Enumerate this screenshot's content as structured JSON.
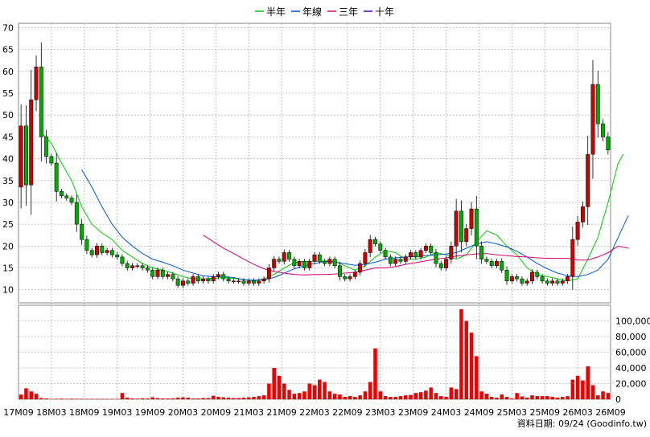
{
  "legend": [
    {
      "name": "半年",
      "color": "#00cc00"
    },
    {
      "name": "年線",
      "color": "#0055dd"
    },
    {
      "name": "三年",
      "color": "#dd0077"
    },
    {
      "name": "十年",
      "color": "#5500aa"
    }
  ],
  "footer_note": "資料日期: 09/24  (Goodinfo.tw)",
  "colors": {
    "up": "#cc0000",
    "down": "#00aa00",
    "volume": "#ee0000",
    "grid": "#999999"
  },
  "chart_data": {
    "type": "candlestick",
    "price_axis": {
      "min": 7,
      "max": 71,
      "ticks": [
        10,
        15,
        20,
        25,
        30,
        35,
        40,
        45,
        50,
        55,
        60,
        65,
        70
      ]
    },
    "volume_axis": {
      "min": 0,
      "max": 120000,
      "ticks": [
        0,
        20000,
        40000,
        60000,
        80000,
        100000
      ],
      "tick_labels": [
        "0",
        "20,000",
        "40,000",
        "60,000",
        "80,000",
        "100,000"
      ]
    },
    "x_labels": [
      "17M09",
      "18M03",
      "18M09",
      "19M03",
      "19M09",
      "20M03",
      "20M09",
      "21M03",
      "21M09",
      "22M03",
      "22M09",
      "23M03",
      "23M09",
      "24M03",
      "24M09",
      "25M03",
      "25M09",
      "26M03",
      "26M09"
    ],
    "close": [
      47.5,
      34,
      53.5,
      61,
      45,
      40.5,
      39,
      32.5,
      31.5,
      31,
      30,
      25,
      21.5,
      19,
      18,
      20,
      18.5,
      19,
      18,
      17.5,
      16,
      15,
      15.5,
      15.5,
      15,
      14.5,
      13,
      14.5,
      13,
      13.5,
      12.5,
      11,
      12,
      11.5,
      13,
      12,
      12.5,
      12,
      13,
      13.5,
      12.5,
      12,
      12,
      12,
      11.5,
      12,
      11.5,
      12,
      12.5,
      15,
      17,
      16.5,
      18.5,
      17,
      15.5,
      16.5,
      15,
      16.5,
      18,
      16.5,
      16,
      17,
      15.5,
      13,
      12.5,
      13,
      14,
      16,
      18.5,
      21.5,
      20.5,
      19,
      17.5,
      16,
      17,
      16.5,
      17.5,
      18.5,
      17.5,
      19,
      20,
      18.5,
      16,
      15,
      17,
      20,
      28,
      21,
      24,
      28.5,
      20,
      17,
      16.5,
      15.5,
      16.5,
      14.5,
      12,
      13,
      12.5,
      11.5,
      12,
      14,
      13,
      12,
      11.5,
      12,
      11.5,
      12,
      13,
      21.5,
      25.5,
      29,
      41,
      57,
      48,
      45,
      42
    ],
    "volume": [
      6000,
      14000,
      10000,
      7000,
      1500,
      1000,
      500,
      600,
      800,
      500,
      700,
      600,
      600,
      500,
      500,
      400,
      400,
      300,
      500,
      400,
      8000,
      2000,
      1000,
      800,
      1200,
      1000,
      2500,
      1500,
      1000,
      1000,
      1200,
      2000,
      2500,
      2000,
      1000,
      1000,
      1500,
      1500,
      4500,
      3000,
      2500,
      2000,
      1500,
      1500,
      2000,
      2500,
      3000,
      4000,
      5000,
      20000,
      40000,
      30000,
      20000,
      12000,
      7000,
      8000,
      10000,
      20000,
      18000,
      25000,
      22000,
      10000,
      7000,
      6000,
      3000,
      4000,
      3000,
      5000,
      10000,
      22000,
      65000,
      10000,
      4000,
      3000,
      3000,
      4000,
      5000,
      5500,
      8000,
      9000,
      11000,
      15000,
      8000,
      4000,
      3000,
      15000,
      13000,
      115000,
      100000,
      85000,
      55000,
      10000,
      7000,
      3000,
      2000,
      6000,
      3000,
      1000,
      8000,
      3500,
      2000,
      5000,
      4000,
      4000,
      4000,
      3000,
      2000,
      3000,
      4000,
      25000,
      30000,
      24000,
      42000,
      18000,
      5000,
      10000,
      8000
    ],
    "ma_halfyear": [
      [
        4,
        46
      ],
      [
        6,
        43.5
      ],
      [
        8,
        39
      ],
      [
        10,
        35
      ],
      [
        12,
        29
      ],
      [
        14,
        25
      ],
      [
        16,
        23
      ],
      [
        18,
        21.5
      ],
      [
        20,
        19
      ],
      [
        22,
        17.5
      ],
      [
        24,
        16
      ],
      [
        26,
        15
      ],
      [
        28,
        14.5
      ],
      [
        30,
        13.8
      ],
      [
        32,
        13
      ],
      [
        34,
        12.5
      ],
      [
        36,
        12.5
      ],
      [
        38,
        12.6
      ],
      [
        40,
        12.8
      ],
      [
        42,
        12.6
      ],
      [
        44,
        12.4
      ],
      [
        46,
        12
      ],
      [
        48,
        12.5
      ],
      [
        50,
        13.5
      ],
      [
        52,
        15
      ],
      [
        54,
        16.2
      ],
      [
        56,
        16.5
      ],
      [
        58,
        16.5
      ],
      [
        60,
        16.6
      ],
      [
        62,
        16.5
      ],
      [
        64,
        15.5
      ],
      [
        66,
        14.5
      ],
      [
        68,
        15.5
      ],
      [
        70,
        17.5
      ],
      [
        72,
        19
      ],
      [
        74,
        18.5
      ],
      [
        76,
        17
      ],
      [
        78,
        17
      ],
      [
        80,
        17.5
      ],
      [
        82,
        18.5
      ],
      [
        84,
        18
      ],
      [
        86,
        17
      ],
      [
        88,
        18
      ],
      [
        90,
        21
      ],
      [
        92,
        23.5
      ],
      [
        94,
        22.5
      ],
      [
        96,
        20
      ],
      [
        98,
        18
      ],
      [
        100,
        15
      ],
      [
        102,
        13.5
      ],
      [
        104,
        13
      ],
      [
        106,
        12.5
      ],
      [
        108,
        12
      ],
      [
        110,
        12.5
      ],
      [
        112,
        17
      ],
      [
        114,
        22
      ],
      [
        116,
        30
      ],
      [
        118,
        39
      ],
      [
        119,
        41
      ]
    ],
    "ma_year": [
      [
        12,
        37.5
      ],
      [
        14,
        33.5
      ],
      [
        16,
        29
      ],
      [
        18,
        25
      ],
      [
        20,
        22
      ],
      [
        22,
        20
      ],
      [
        24,
        18.3
      ],
      [
        26,
        17
      ],
      [
        28,
        16.3
      ],
      [
        30,
        15.5
      ],
      [
        32,
        14.5
      ],
      [
        34,
        13.8
      ],
      [
        36,
        13.2
      ],
      [
        38,
        13
      ],
      [
        40,
        13
      ],
      [
        42,
        12.8
      ],
      [
        44,
        12.3
      ],
      [
        46,
        12.2
      ],
      [
        48,
        12.3
      ],
      [
        50,
        12.8
      ],
      [
        52,
        13.8
      ],
      [
        54,
        14.8
      ],
      [
        56,
        15.5
      ],
      [
        58,
        16
      ],
      [
        60,
        16.5
      ],
      [
        62,
        16.3
      ],
      [
        64,
        16
      ],
      [
        66,
        15.6
      ],
      [
        68,
        15.8
      ],
      [
        70,
        16.3
      ],
      [
        72,
        17
      ],
      [
        74,
        17.3
      ],
      [
        76,
        17.5
      ],
      [
        78,
        17.6
      ],
      [
        80,
        17.8
      ],
      [
        82,
        18
      ],
      [
        84,
        18.2
      ],
      [
        86,
        18.5
      ],
      [
        88,
        19.5
      ],
      [
        90,
        20.5
      ],
      [
        92,
        21
      ],
      [
        94,
        20.5
      ],
      [
        96,
        19.8
      ],
      [
        98,
        18.8
      ],
      [
        100,
        17.5
      ],
      [
        102,
        16
      ],
      [
        104,
        14.8
      ],
      [
        106,
        13.8
      ],
      [
        108,
        13.2
      ],
      [
        110,
        13
      ],
      [
        112,
        13.5
      ],
      [
        114,
        14.5
      ],
      [
        116,
        17
      ],
      [
        118,
        22
      ],
      [
        120,
        27
      ]
    ],
    "ma_3year": [
      [
        36,
        22.5
      ],
      [
        38,
        21
      ],
      [
        40,
        19.5
      ],
      [
        42,
        18.3
      ],
      [
        44,
        17
      ],
      [
        46,
        15.8
      ],
      [
        48,
        14.8
      ],
      [
        50,
        14.2
      ],
      [
        52,
        13.8
      ],
      [
        54,
        13.5
      ],
      [
        56,
        13.4
      ],
      [
        58,
        13.5
      ],
      [
        60,
        13.5
      ],
      [
        62,
        13.6
      ],
      [
        64,
        13.8
      ],
      [
        66,
        14
      ],
      [
        68,
        14.5
      ],
      [
        70,
        15
      ],
      [
        72,
        15
      ],
      [
        74,
        15.3
      ],
      [
        76,
        15.8
      ],
      [
        78,
        16.2
      ],
      [
        80,
        16.6
      ],
      [
        82,
        17
      ],
      [
        84,
        17.3
      ],
      [
        86,
        17.7
      ],
      [
        88,
        18
      ],
      [
        90,
        18.2
      ],
      [
        92,
        18.3
      ],
      [
        94,
        18
      ],
      [
        96,
        17.8
      ],
      [
        98,
        17.6
      ],
      [
        100,
        17.5
      ],
      [
        102,
        17.3
      ],
      [
        104,
        17.2
      ],
      [
        106,
        17.2
      ],
      [
        108,
        17.2
      ],
      [
        110,
        16.8
      ],
      [
        112,
        16.8
      ],
      [
        114,
        17.5
      ],
      [
        116,
        18.5
      ],
      [
        118,
        20
      ],
      [
        120,
        19.5
      ]
    ]
  }
}
